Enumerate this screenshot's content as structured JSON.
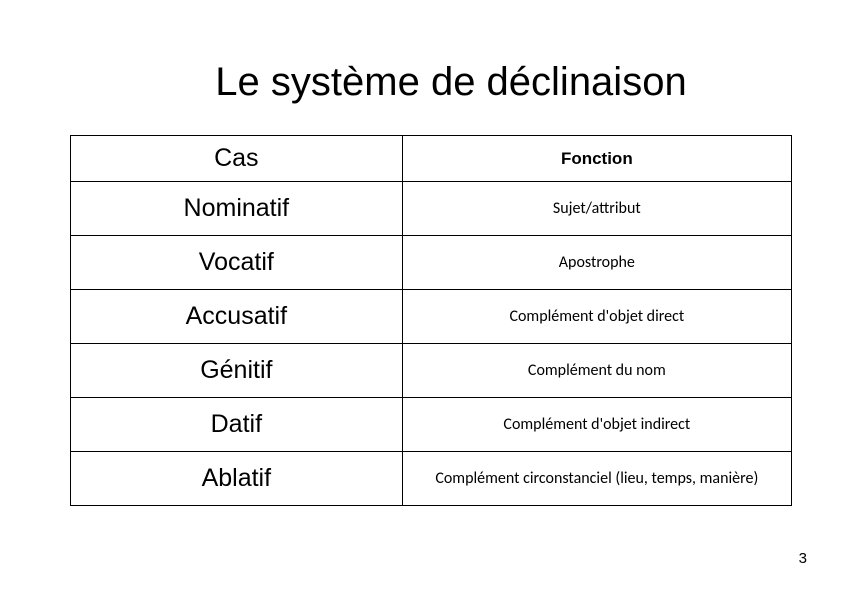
{
  "title": "Le système de déclinaison",
  "headers": {
    "cas": "Cas",
    "fonction": "Fonction"
  },
  "rows": [
    {
      "cas": "Nominatif",
      "fonction": "Sujet/attribut"
    },
    {
      "cas": "Vocatif",
      "fonction": "Apostrophe"
    },
    {
      "cas": "Accusatif",
      "fonction": "Complément d'objet direct"
    },
    {
      "cas": "Génitif",
      "fonction": "Complément du nom"
    },
    {
      "cas": "Datif",
      "fonction": "Complément d'objet indirect"
    },
    {
      "cas": "Ablatif",
      "fonction": "Complément circonstanciel (lieu, temps, manière)"
    }
  ],
  "pageNumber": "3"
}
